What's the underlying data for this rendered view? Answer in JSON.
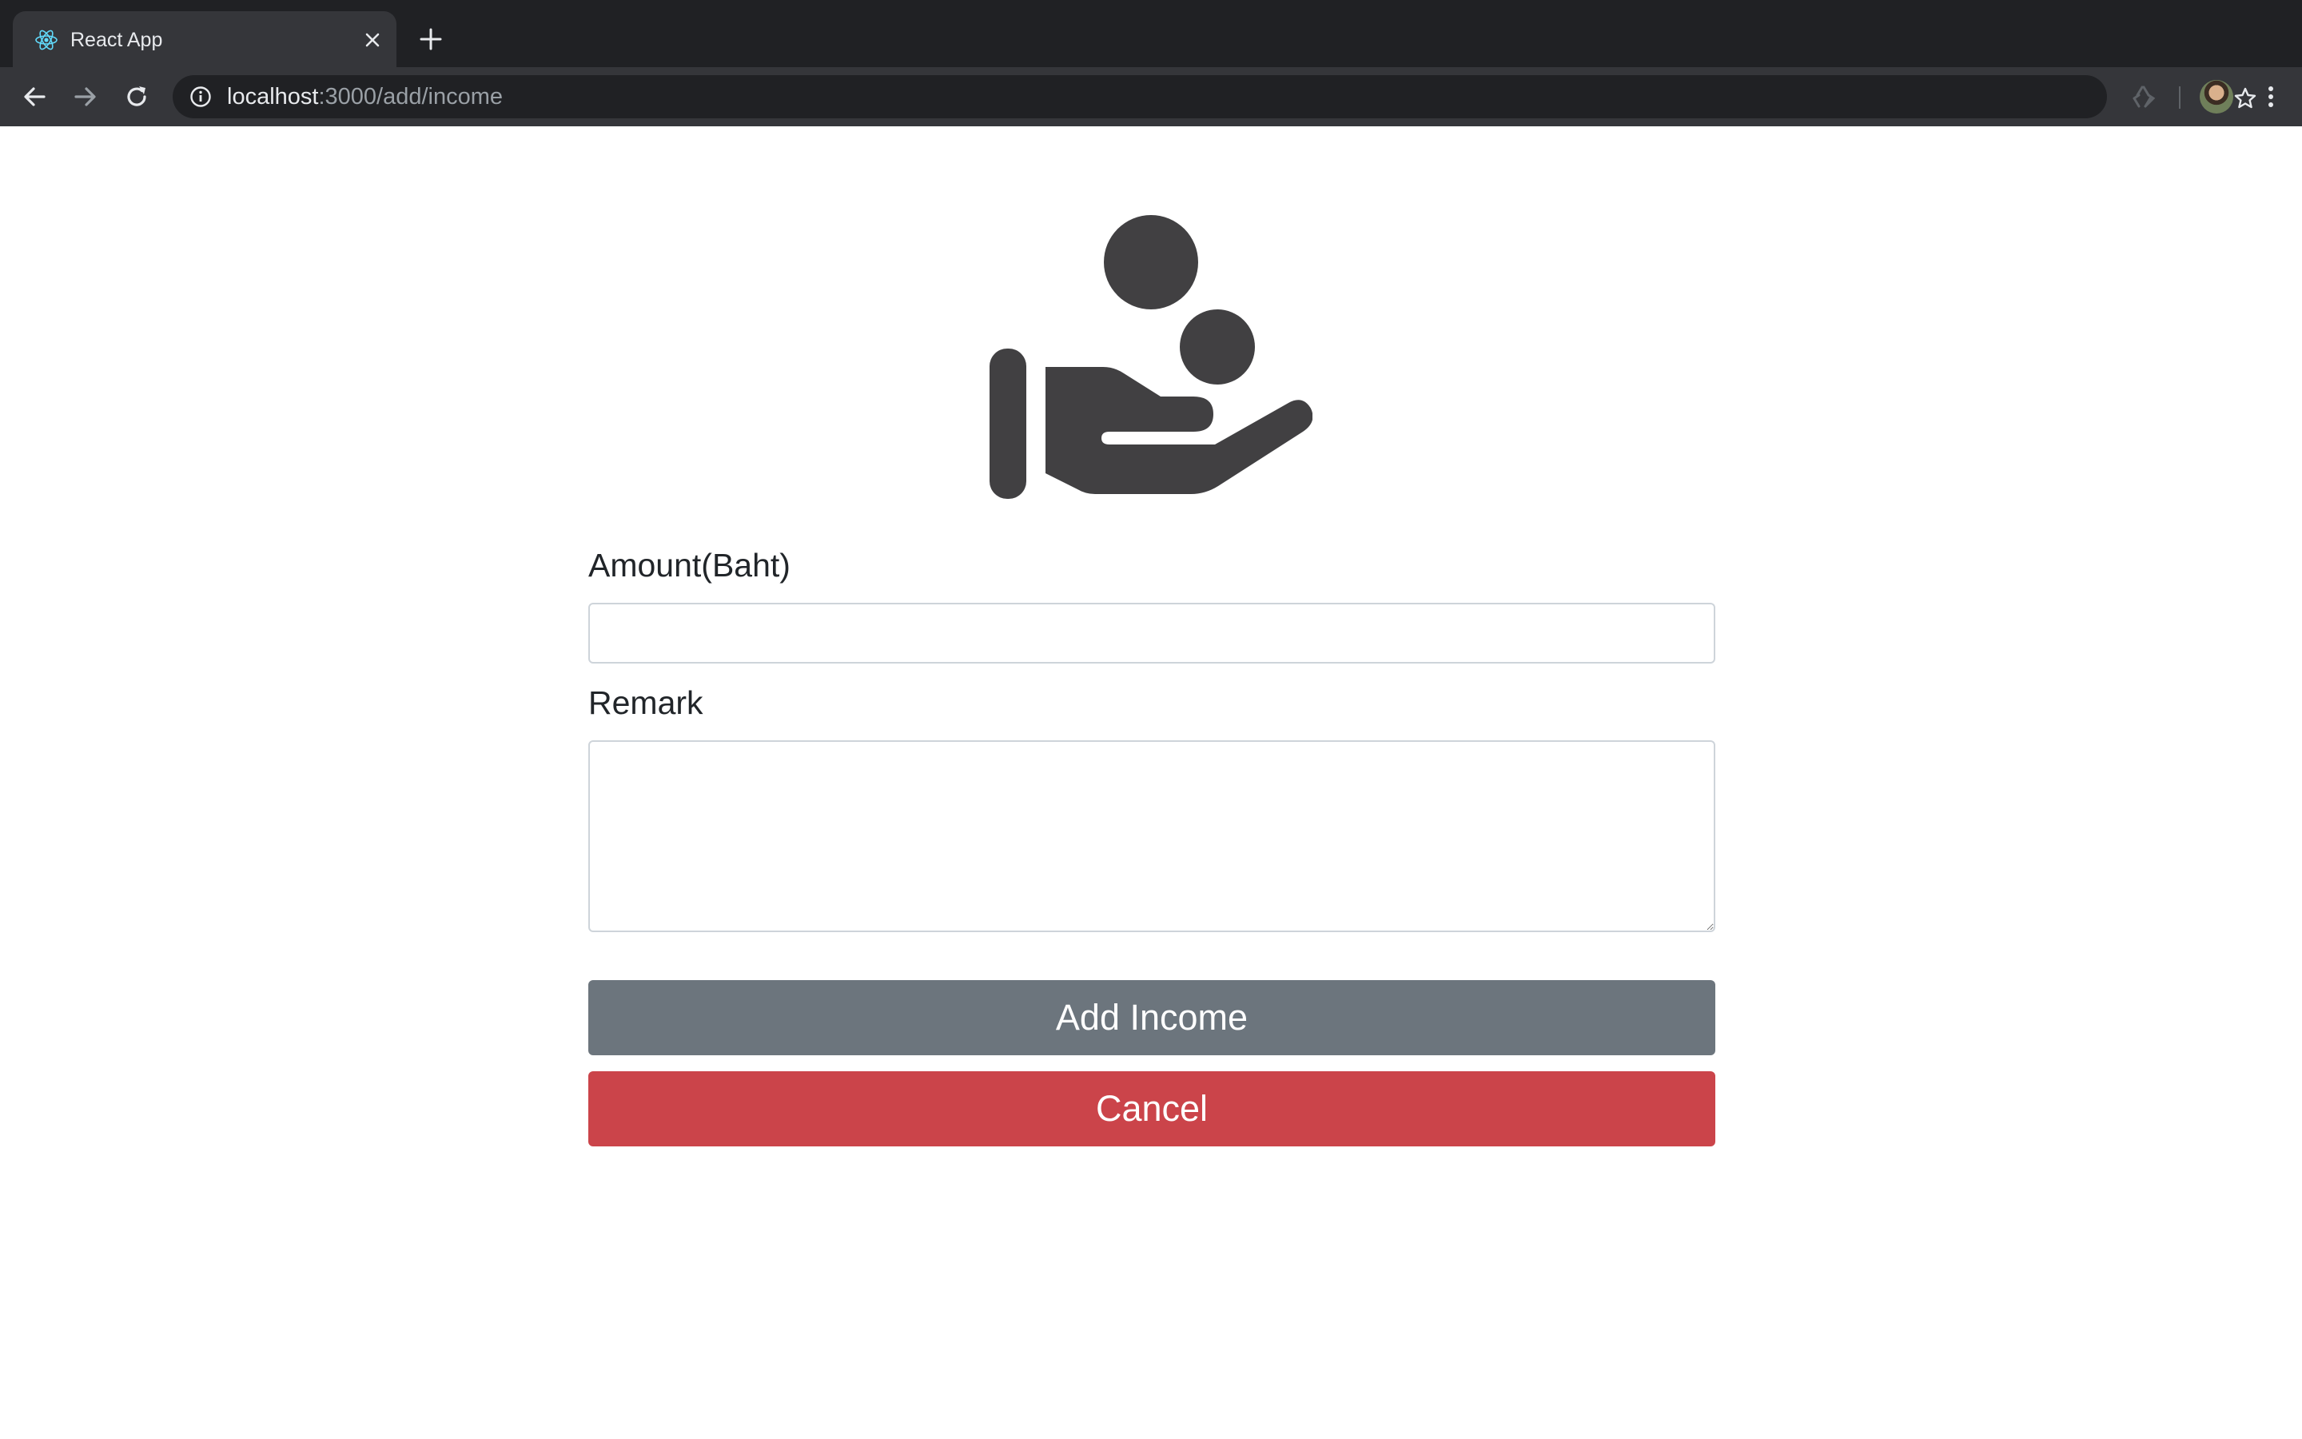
{
  "browser": {
    "tab_title": "React App",
    "url_host": "localhost",
    "url_path": ":3000/add/income"
  },
  "icons": {
    "tab_favicon": "react-icon",
    "tab_close": "close-icon",
    "new_tab": "plus-icon",
    "back": "arrow-left-icon",
    "forward": "arrow-right-icon",
    "reload": "reload-icon",
    "site_info": "info-icon",
    "bookmark": "star-icon",
    "extension": "recycle-icon",
    "menu": "more-vert-icon",
    "hero": "hand-holding-coins-icon"
  },
  "form": {
    "amount_label": "Amount(Baht)",
    "amount_value": "",
    "remark_label": "Remark",
    "remark_value": "",
    "submit_label": "Add Income",
    "cancel_label": "Cancel"
  },
  "colors": {
    "submit_bg": "#6c757d",
    "cancel_bg": "#cb444a",
    "icon": "#414042"
  }
}
